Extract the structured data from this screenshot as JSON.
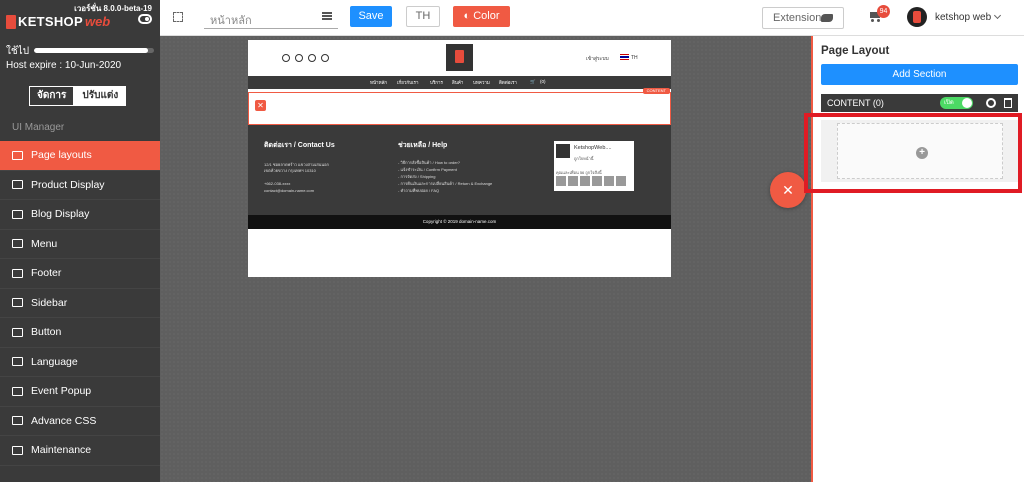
{
  "sidebar": {
    "version": "เวอร์ชั่น 8.0.0-beta-19",
    "brand": "KETSHOP",
    "brand_suffix": "web",
    "usage_label": "ใช้ไป",
    "usage_fraction": 0.95,
    "host_expire": "Host expire : 10-Jun-2020",
    "modes": [
      "จัดการ",
      "ปรับแต่ง"
    ],
    "section_label": "UI Manager",
    "items": [
      {
        "label": "Page layouts",
        "active": true
      },
      {
        "label": "Product Display"
      },
      {
        "label": "Blog Display"
      },
      {
        "label": "Menu"
      },
      {
        "label": "Footer"
      },
      {
        "label": "Sidebar"
      },
      {
        "label": "Button"
      },
      {
        "label": "Language"
      },
      {
        "label": "Event Popup"
      },
      {
        "label": "Advance CSS"
      },
      {
        "label": "Maintenance"
      }
    ]
  },
  "topbar": {
    "page_placeholder": "หน้าหลัก",
    "save_label": "Save",
    "lang_label": "TH",
    "color_label": "Color",
    "extension_label": "Extension",
    "cart_count": "94",
    "username": "ketshop web"
  },
  "preview": {
    "login": "เข้าสู่ระบบ",
    "lang": "TH",
    "nav": [
      "หน้าหลัก",
      "เกี่ยวกับเรา",
      "บริการ",
      "สินค้า",
      "บทความ",
      "ติดต่อเรา",
      "(0)"
    ],
    "content_tag": "CONTENT",
    "footer_contact_title": "ติดต่อเรา / Contact Us",
    "footer_contact_lines": [
      "12/1 ซอยลาดพร้าว แขวงสามเสนนอก",
      "เขตห้วยขวาง กรุงเทพฯ 10310",
      "+662-038-xxxx",
      "contact@domain-name.com"
    ],
    "footer_help_title": "ช่วยเหลือ / Help",
    "footer_help_lines": [
      "- วิธีการสั่งซื้อสินค้า / How to order?",
      "- แจ้งชำระเงิน / Confirm Payment",
      "- การจัดส่ง / Shipping",
      "- การคืนเงินและการเปลี่ยนสินค้า / Return & Exchange",
      "- คำถามที่พบบ่อย / FAQ"
    ],
    "fb_title": "KetshopWeb....",
    "fb_sub": "ถูกใจหน้านี้",
    "fb_friends": "คุณและเพื่อน 56 ถูกใจสิ่งนี้",
    "copyright": "Copyright © 2019 domain-name.com"
  },
  "panel": {
    "title": "Page Layout",
    "add_section": "Add Section",
    "content_label": "CONTENT (0)",
    "toggle_label": "เปิด"
  },
  "colors": {
    "accent": "#f05a43",
    "primary": "#1e90ff",
    "highlight": "#e01b24"
  }
}
